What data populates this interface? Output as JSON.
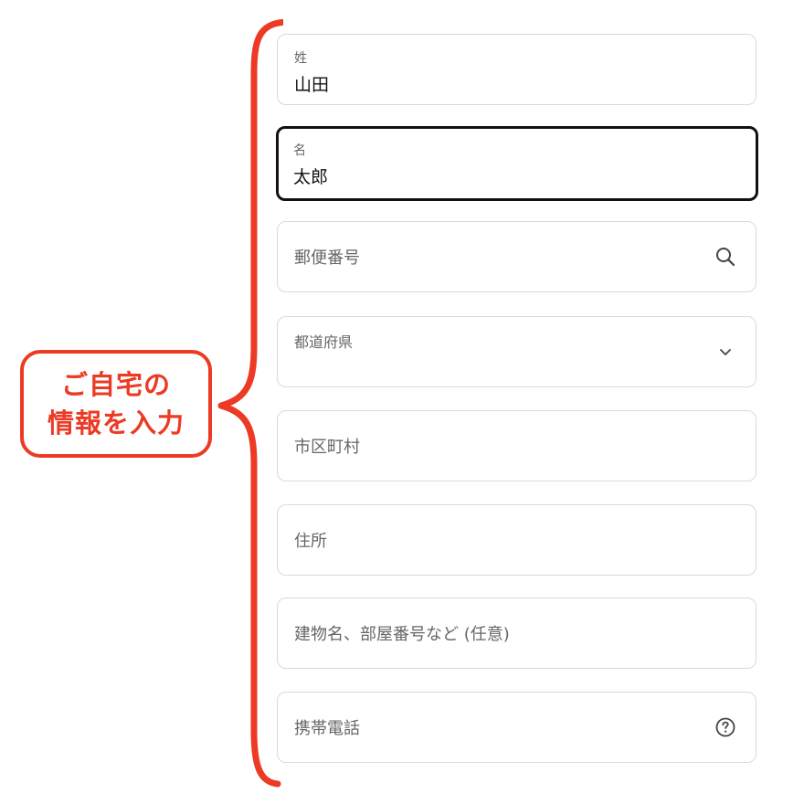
{
  "form": {
    "last_name": {
      "label": "姓",
      "value": "山田"
    },
    "first_name": {
      "label": "名",
      "value": "太郎"
    },
    "postal_code": {
      "placeholder": "郵便番号",
      "icon": "search-icon"
    },
    "prefecture": {
      "label": "都道府県",
      "icon": "chevron-down-icon"
    },
    "city": {
      "placeholder": "市区町村"
    },
    "address": {
      "placeholder": "住所"
    },
    "building": {
      "placeholder": "建物名、部屋番号など (任意)"
    },
    "phone": {
      "placeholder": "携帯電話",
      "icon": "help-circle-icon"
    }
  },
  "annotation": {
    "line1": "ご自宅の",
    "line2": "情報を入力",
    "color": "#ec3a24"
  }
}
